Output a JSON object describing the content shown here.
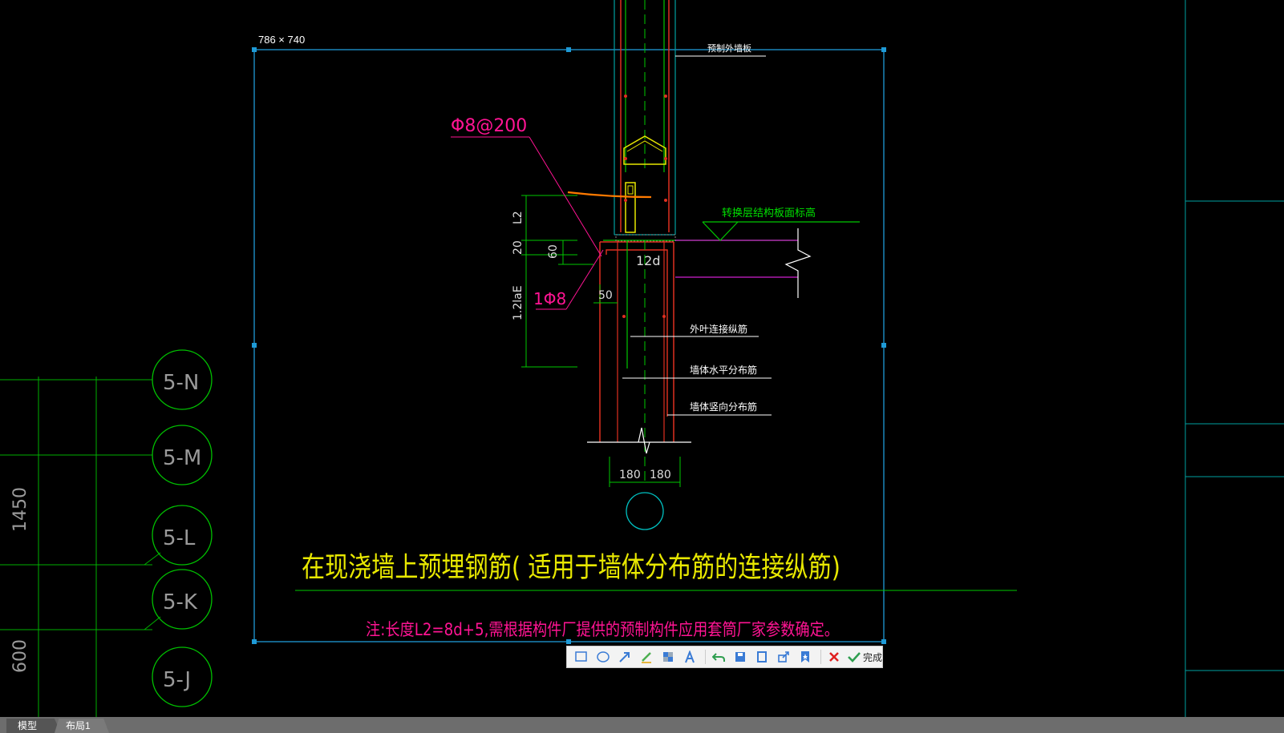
{
  "selection": {
    "size_label": "786 × 740"
  },
  "drawing": {
    "title": "在现浇墙上预埋钢筋( 适用于墙体分布筋的连接纵筋)",
    "note": "注:长度L2=8d+5,需根据构件厂提供的预制构件应用套筒厂家参数确定。",
    "labels": {
      "precast_wall": "预制外墙板",
      "bar_spacing": "Φ8@200",
      "bar_single": "1Φ8",
      "slab_elevation": "转换层结构板面标高",
      "connecting_bar": "外叶连接纵筋",
      "horizontal_bar": "墙体水平分布筋",
      "vertical_bar": "墙体竖向分布筋"
    },
    "dims": {
      "l2": "L2",
      "d20": "20",
      "d60": "60",
      "d12d": "12d",
      "d12lae": "1.2laE",
      "d50": "50",
      "w_left": "180",
      "w_right": "180"
    },
    "axes": [
      "5-N",
      "5-M",
      "5-L",
      "5-K",
      "5-J"
    ],
    "left_dims": [
      "1450",
      "600"
    ]
  },
  "toolbar": {
    "done_label": "完成",
    "icons": [
      "rectangle-icon",
      "ellipse-icon",
      "arrow-icon",
      "pen-icon",
      "mosaic-icon",
      "text-icon",
      "undo-icon",
      "save-icon",
      "copy-icon",
      "share-icon",
      "pin-icon",
      "cancel-icon",
      "check-icon"
    ]
  },
  "tabs": [
    "模型",
    "布局1"
  ],
  "colors": {
    "background": "#000000",
    "selection": "#1e9ad6",
    "green": "#00c800",
    "red": "#e03020",
    "magenta": "#ff1493",
    "yellow": "#e8e800",
    "white": "#ffffff",
    "cyan": "#00c0c0"
  }
}
